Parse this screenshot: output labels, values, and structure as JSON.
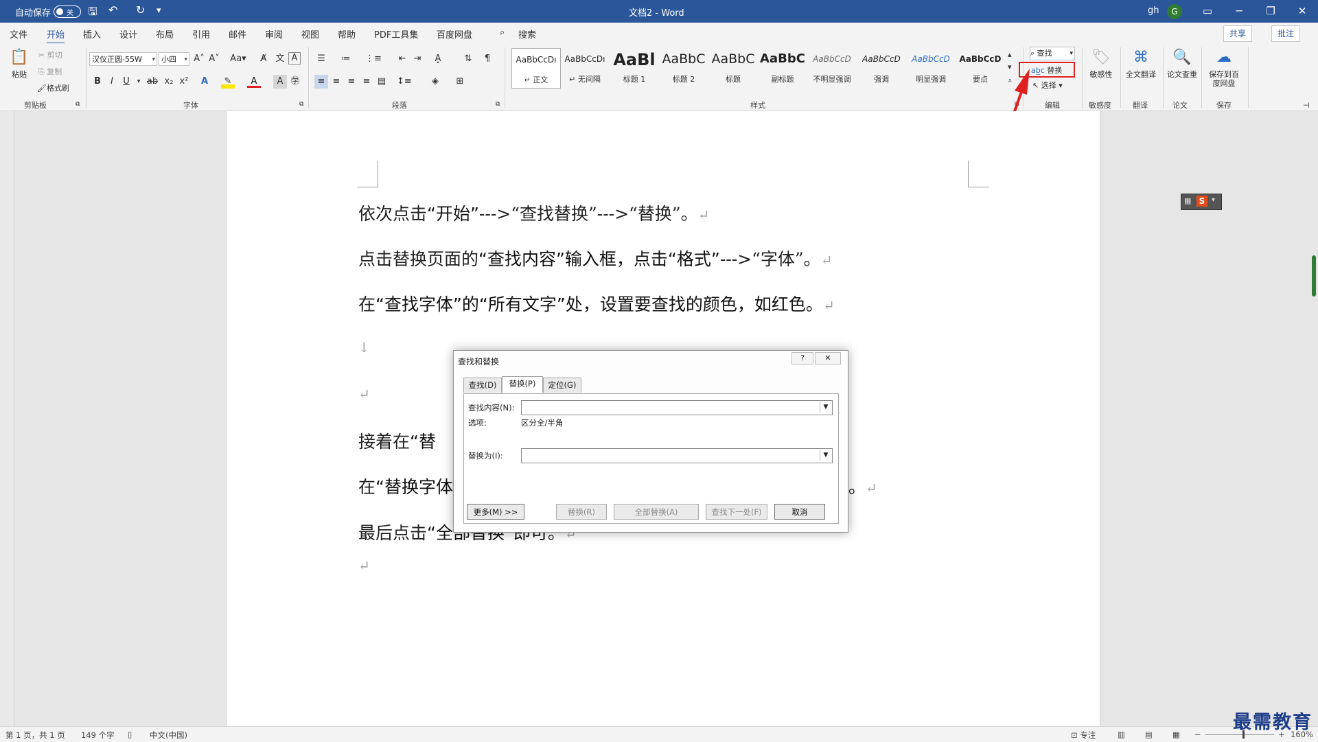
{
  "titlebar": {
    "autosave_label": "自动保存",
    "autosave_state": "关",
    "doc_title": "文档2 - Word",
    "user_initials": "gh",
    "avatar_letter": "G"
  },
  "menu": {
    "tabs": [
      "文件",
      "开始",
      "插入",
      "设计",
      "布局",
      "引用",
      "邮件",
      "审阅",
      "视图",
      "帮助",
      "PDF工具集",
      "百度网盘"
    ],
    "active_tab": "开始",
    "search_label": "搜索",
    "share_label": "共享",
    "comment_label": "批注"
  },
  "ribbon": {
    "clipboard": {
      "paste": "粘贴",
      "cut": "剪切",
      "copy": "复制",
      "format_painter": "格式刷",
      "group_label": "剪贴板"
    },
    "font": {
      "font_name": "汉仪正圆-55W",
      "font_size": "小四",
      "case_label": "Aa",
      "group_label": "字体"
    },
    "paragraph": {
      "group_label": "段落"
    },
    "styles": {
      "group_label": "样式",
      "items": [
        {
          "sample": "AaBbCcDı",
          "name": "↵ 正文"
        },
        {
          "sample": "AaBbCcDı",
          "name": "↵ 无间隔"
        },
        {
          "sample": "AaBl",
          "name": "标题 1"
        },
        {
          "sample": "AaBbC",
          "name": "标题 2"
        },
        {
          "sample": "AaBbC",
          "name": "标题"
        },
        {
          "sample": "AaBbC",
          "name": "副标题"
        },
        {
          "sample": "AaBbCcD",
          "name": "不明显强调"
        },
        {
          "sample": "AaBbCcD",
          "name": "强调"
        },
        {
          "sample": "AaBbCcD",
          "name": "明显强调"
        },
        {
          "sample": "AaBbCcD",
          "name": "要点"
        }
      ]
    },
    "editing": {
      "find": "查找",
      "replace": "替换",
      "select": "选择",
      "group_label": "编辑"
    },
    "sensitivity": {
      "label": "敏感性",
      "group_label": "敏感度"
    },
    "translate": {
      "label": "全文翻译",
      "group_label": "翻译"
    },
    "paper": {
      "label": "论文查重",
      "group_label": "论文"
    },
    "save": {
      "label": "保存到百度网盘",
      "group_label": "保存"
    }
  },
  "document": {
    "paragraphs": [
      {
        "pre": "依次点击",
        "b1": "“开始”",
        "mid": "--->“查找替换”--->“替换”。",
        "b2": "",
        "post": ""
      },
      {
        "pre": "点击替换页面的",
        "b1": "“查找内容”输入框，点击“格式”",
        "mid": "--->“字体”。",
        "b2": "",
        "post": ""
      },
      {
        "pre": "在",
        "b1": "“查找字体”的“所有文字”处，设置要查找的颜色，如红色。",
        "mid": "",
        "b2": "",
        "post": ""
      },
      {
        "pre": "",
        "b1": "",
        "mid": "",
        "b2": "",
        "post": ""
      },
      {
        "pre": "",
        "b1": "",
        "mid": "",
        "b2": "",
        "post": ""
      },
      {
        "pre": "接着在",
        "b1": "“替",
        "mid": "",
        "b2": "",
        "post": ""
      },
      {
        "pre": "在",
        "b1": "“替换字体",
        "mid": "",
        "b2": "",
        "post": ""
      },
      {
        "pre": "最后点击",
        "b1": "“全部替换”即可。",
        "mid": "",
        "b2": "",
        "post": ""
      }
    ],
    "line_break_mark": "↓",
    "para_mark": "↵"
  },
  "dialog": {
    "title": "查找和替换",
    "help": "?",
    "close": "✕",
    "tabs": [
      "查找(D)",
      "替换(P)",
      "定位(G)"
    ],
    "active_tab": "替换(P)",
    "find_label": "查找内容(N):",
    "find_value": "",
    "options_label": "选项:",
    "options_value": "区分全/半角",
    "replace_label": "替换为(I):",
    "replace_value": "",
    "buttons": {
      "more": "更多(M) >>",
      "replace": "替换(R)",
      "replace_all": "全部替换(A)",
      "find_next": "查找下一处(F)",
      "cancel": "取消"
    }
  },
  "statusbar": {
    "page": "第 1 页，共 1 页",
    "words": "149 个字",
    "language": "中文(中国)",
    "focus": "专注",
    "zoom": "160%"
  },
  "watermark": "最需教育",
  "colors": {
    "accent": "#2b579a",
    "highlight_box": "#e02020",
    "arrow": "#e02020"
  }
}
